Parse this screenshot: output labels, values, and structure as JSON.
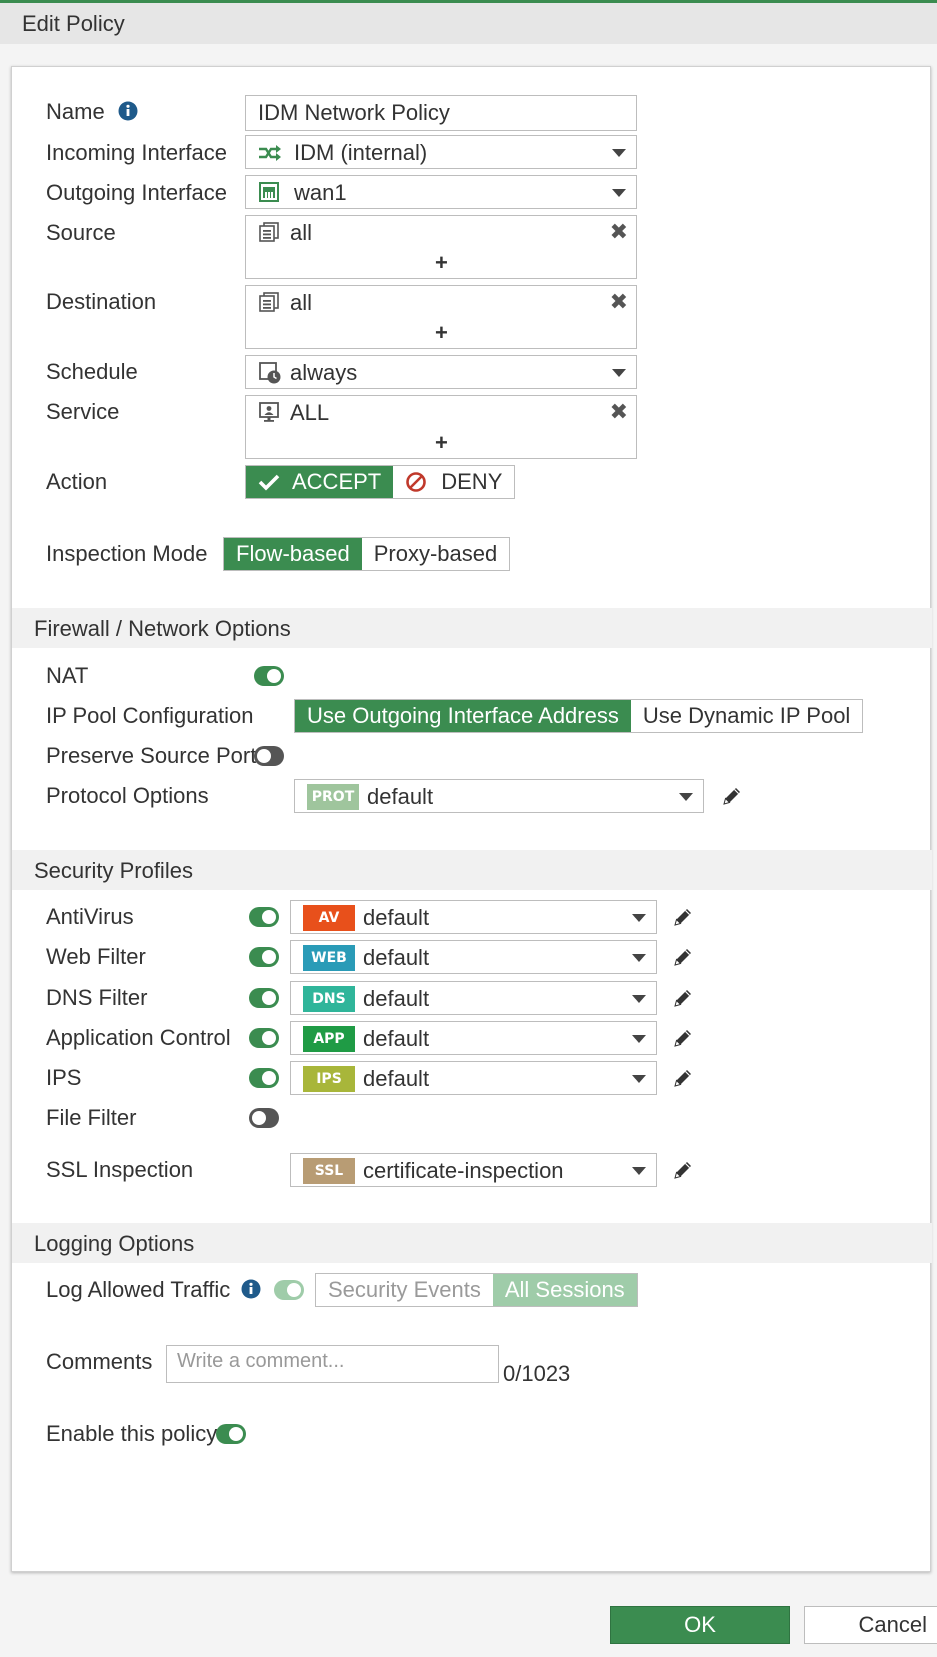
{
  "window": {
    "title": "Edit Policy"
  },
  "policy": {
    "name_label": "Name",
    "name_value": "IDM Network Policy",
    "incoming_label": "Incoming Interface",
    "incoming_value": "IDM (internal)",
    "outgoing_label": "Outgoing Interface",
    "outgoing_value": "wan1",
    "source_label": "Source",
    "source_value": "all",
    "destination_label": "Destination",
    "destination_value": "all",
    "schedule_label": "Schedule",
    "schedule_value": "always",
    "service_label": "Service",
    "service_value": "ALL",
    "add_symbol": "+",
    "remove_symbol": "✖",
    "action_label": "Action",
    "action_accept": "ACCEPT",
    "action_deny": "DENY",
    "action_selected": "ACCEPT",
    "inspection_label": "Inspection Mode",
    "inspection_flow": "Flow-based",
    "inspection_proxy": "Proxy-based",
    "inspection_selected": "Flow-based"
  },
  "firewall": {
    "section_title": "Firewall / Network Options",
    "nat_label": "NAT",
    "nat_enabled": true,
    "ippool_label": "IP Pool Configuration",
    "ippool_outgoing": "Use Outgoing Interface Address",
    "ippool_dynamic": "Use Dynamic IP Pool",
    "ippool_selected": "Use Outgoing Interface Address",
    "preserve_label": "Preserve Source Port",
    "preserve_enabled": false,
    "protocol_label": "Protocol Options",
    "protocol_badge": "PROT",
    "protocol_value": "default"
  },
  "security": {
    "section_title": "Security Profiles",
    "profiles": [
      {
        "label": "AntiVirus",
        "enabled": true,
        "badge": "AV",
        "badge_color": "#e8501b",
        "value": "default"
      },
      {
        "label": "Web Filter",
        "enabled": true,
        "badge": "WEB",
        "badge_color": "#2a9bb7",
        "value": "default"
      },
      {
        "label": "DNS Filter",
        "enabled": true,
        "badge": "DNS",
        "badge_color": "#2fb59a",
        "value": "default"
      },
      {
        "label": "Application Control",
        "enabled": true,
        "badge": "APP",
        "badge_color": "#1f9b45",
        "value": "default"
      },
      {
        "label": "IPS",
        "enabled": true,
        "badge": "IPS",
        "badge_color": "#a8b63a",
        "value": "default"
      }
    ],
    "file_filter_label": "File Filter",
    "file_filter_enabled": false,
    "ssl_label": "SSL Inspection",
    "ssl_badge": "SSL",
    "ssl_badge_color": "#b89c74",
    "ssl_value": "certificate-inspection"
  },
  "logging": {
    "section_title": "Logging Options",
    "log_label": "Log Allowed Traffic",
    "log_enabled": true,
    "log_security": "Security Events",
    "log_all": "All Sessions",
    "log_selected": "All Sessions"
  },
  "comments": {
    "label": "Comments",
    "placeholder": "Write a comment...",
    "counter": "0/1023"
  },
  "enable": {
    "label": "Enable this policy",
    "enabled": true
  },
  "footer": {
    "ok": "OK",
    "cancel": "Cancel"
  },
  "colors": {
    "accent": "#3b8c50",
    "accent_dim": "#9fcca9",
    "deny_red": "#c0392b",
    "info_blue": "#1f5a8a",
    "prot_badge": "#9fc59d"
  }
}
